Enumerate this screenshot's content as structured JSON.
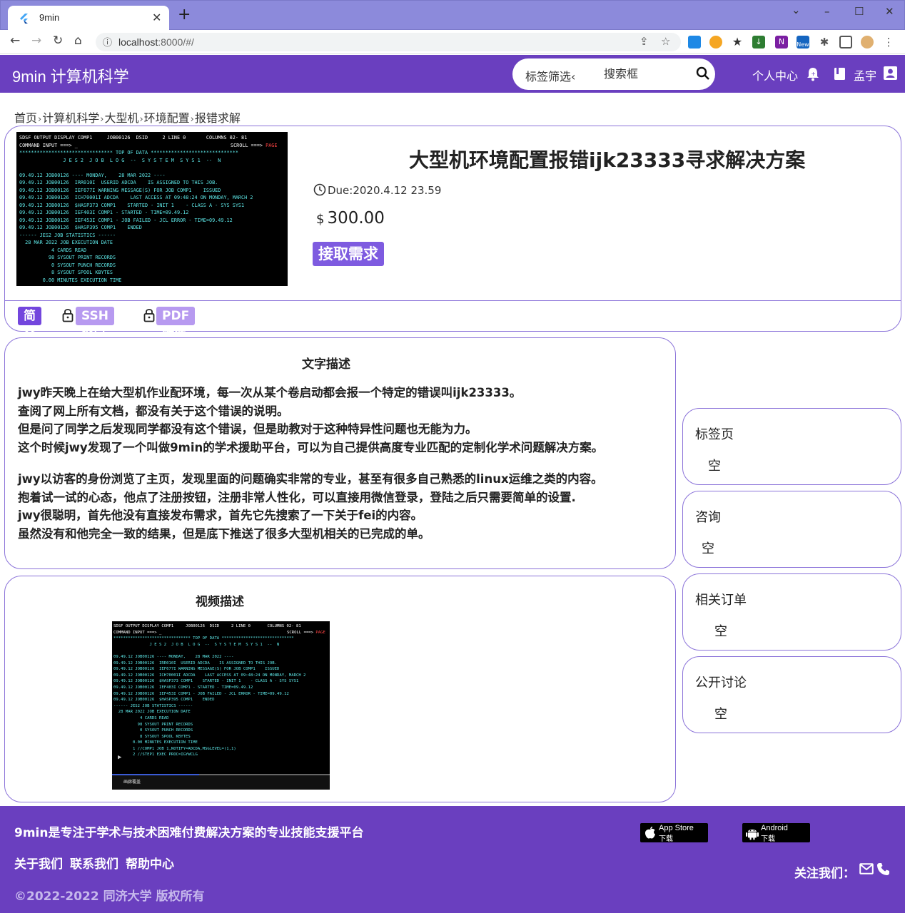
{
  "browser": {
    "tab_title": "9min",
    "new_tab": "+",
    "url_host": "localhost",
    "url_rest": ":8000/#/",
    "ext_new_badge": "New"
  },
  "header": {
    "brand": "9min 计算机科学",
    "tag_filter": "标签筛选‹",
    "search_placeholder": "搜索框",
    "user_center": "个人中心",
    "username": "孟宇"
  },
  "breadcrumb": [
    "首页",
    "计算机科学",
    "大型机",
    "环境配置",
    "报错求解"
  ],
  "job": {
    "title": "大型机环境配置报错ijk23333寻求解决方案",
    "due": "Due:2020.4.12 23.59",
    "currency": "$",
    "price": "300.00",
    "accept_label": "接取需求"
  },
  "tabs": {
    "intro": "简介",
    "ssh": "SSH窗口",
    "pdf": "PDF附件"
  },
  "terminal": {
    "status_left": "SDSF OUTPUT DISPLAY COMP1     JOB00126  DSID     2 LINE 0       COLUMNS 02- 81",
    "command_input": "COMMAND INPUT ===> _",
    "scroll": "SCROLL ===>",
    "page": "PAGE",
    "top_of_data": "******************************** TOP OF DATA ******************************",
    "job_log_header": "               J E S 2  J O B  L O G  --  S Y S T E M  S Y S 1  --  N",
    "lines": [
      "09.49.12 JOB00126 ---- MONDAY,    28 MAR 2022 ----",
      "09.49.12 JOB00126  IRR010I  USERID ADCDA    IS ASSIGNED TO THIS JOB.",
      "09.49.12 JOB00126  IEF677I WARNING MESSAGE(S) FOR JOB COMP1    ISSUED",
      "09.49.12 JOB00126  ICH70001I ADCDA    LAST ACCESS AT 09:48:24 ON MONDAY, MARCH 2",
      "09.49.12 JOB00126  $HASP373 COMP1    STARTED - INIT 1    - CLASS A - SYS SYS1",
      "09.49.12 JOB00126  IEF403I COMP1 - STARTED - TIME=09.49.12",
      "09.49.12 JOB00126  IEF453I COMP1 - JOB FAILED - JCL ERROR - TIME=09.49.12",
      "09.49.12 JOB00126  $HASP395 COMP1    ENDED",
      "------ JES2 JOB STATISTICS ------",
      "  28 MAR 2022 JOB EXECUTION DATE",
      "           4 CARDS READ",
      "          98 SYSOUT PRINT RECORDS",
      "           0 SYSOUT PUNCH RECORDS",
      "           8 SYSOUT SPOOL KBYTES",
      "        0.00 MINUTES EXECUTION TIME"
    ],
    "extra_lines": [
      "        1 //COMP1 JOB 1,NOTIFY=ADCDA,MSGLEVEL=(1,1)",
      "        2 //STEP1 EXEC PROC=IGYWCLG"
    ],
    "video_label": "画廊覆盖"
  },
  "text_desc": {
    "title": "文字描述",
    "para1": [
      "jwy昨天晚上在给大型机作业配环境，每一次从某个卷启动都会报一个特定的错误叫ijk23333。",
      "查阅了网上所有文档，都没有关于这个错误的说明。",
      "但是问了同学之后发现同学都没有这个错误，但是助教对于这种特异性问题也无能为力。",
      "这个时候jwy发现了一个叫做9min的学术援助平台，可以为自己提供高度专业匹配的定制化学术问题解决方案。"
    ],
    "para2": [
      "jwy以访客的身份浏览了主页，发现里面的问题确实非常的专业，甚至有很多自己熟悉的linux运维之类的内容。",
      "抱着试一试的心态，他点了注册按钮，注册非常人性化，可以直接用微信登录，登陆之后只需要简单的设置.",
      "jwy很聪明，首先他没有直接发布需求，首先它先搜索了一下关于fei的内容。",
      "虽然没有和他完全一致的结果，但是底下推送了很多大型机相关的已完成的单。"
    ]
  },
  "video_desc": {
    "title": "视频描述"
  },
  "sidebar": [
    {
      "title": "标签页",
      "value": "空"
    },
    {
      "title": "咨询",
      "value": "空"
    },
    {
      "title": "相关订单",
      "value": "空"
    },
    {
      "title": "公开讨论",
      "value": "空"
    }
  ],
  "footer": {
    "tagline": "9min是专注于学术与技术困难付费解决方案的专业技能支援平台",
    "links": [
      "关于我们",
      "联系我们",
      "帮助中心"
    ],
    "copyright": "©2022-2022  同济大学  版权所有",
    "appstore": {
      "name": "App Store",
      "sub": "下载"
    },
    "android": {
      "name": "Android",
      "sub": "下载"
    },
    "follow": "关注我们："
  },
  "colors": {
    "brand_purple": "#6a3fbf",
    "accent": "#7e5be0",
    "card_border": "#8b73d9",
    "terminal_text": "#5ee8e8"
  }
}
